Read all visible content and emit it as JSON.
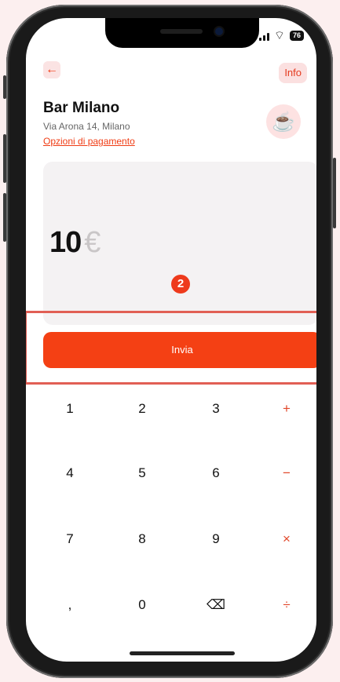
{
  "header": {
    "info_label": "Info"
  },
  "merchant": {
    "name": "Bar Milano",
    "address": "Via Arona 14, Milano",
    "payment_options_link": "Opzioni di pagamento"
  },
  "amount": {
    "value": "10",
    "currency": "€"
  },
  "step_badge": "2",
  "send_button_label": "Invia",
  "keypad": {
    "row1": [
      "1",
      "2",
      "3",
      "+"
    ],
    "row2": [
      "4",
      "5",
      "6",
      "−"
    ],
    "row3": [
      "7",
      "8",
      "9",
      "×"
    ],
    "row4": [
      ",",
      "0",
      "⌫",
      "÷"
    ]
  },
  "status_bar": {
    "battery": "76"
  },
  "icons": {
    "back": "arrow-left-icon",
    "merchant_avatar": "coffee-cup-icon",
    "delete": "backspace-icon"
  },
  "colors": {
    "accent": "#f44014",
    "highlight_border": "#e15f55",
    "background": "#fcefef"
  }
}
